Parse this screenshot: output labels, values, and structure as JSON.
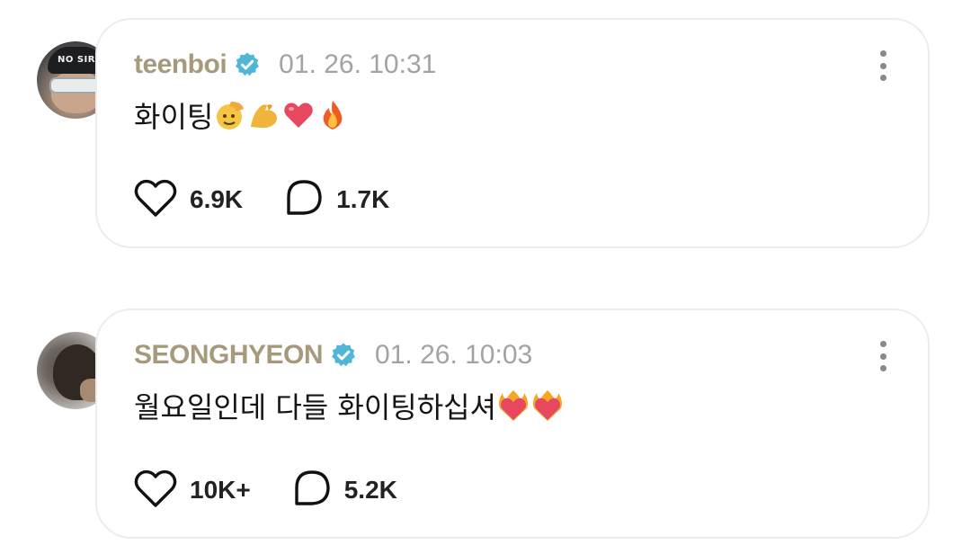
{
  "posts": [
    {
      "username": "teenboi",
      "verified": true,
      "timestamp": "01. 26. 10:31",
      "text": "화이팅",
      "emojis": [
        "saluting-face",
        "flexed-biceps",
        "red-heart",
        "fire"
      ],
      "avatar_cap_text": "NO SIR",
      "likes": "6.9K",
      "comments": "1.7K"
    },
    {
      "username": "SEONGHYEON",
      "verified": true,
      "timestamp": "01. 26. 10:03",
      "text": "월요일인데 다들 화이팅하십셔",
      "emojis": [
        "heart-on-fire",
        "heart-on-fire"
      ],
      "likes": "10K+",
      "comments": "5.2K"
    }
  ],
  "colors": {
    "username": "#a59a7c",
    "timestamp": "#a3a3a3",
    "verified_badge": "#4fb6d6",
    "card_border": "#ececec"
  }
}
